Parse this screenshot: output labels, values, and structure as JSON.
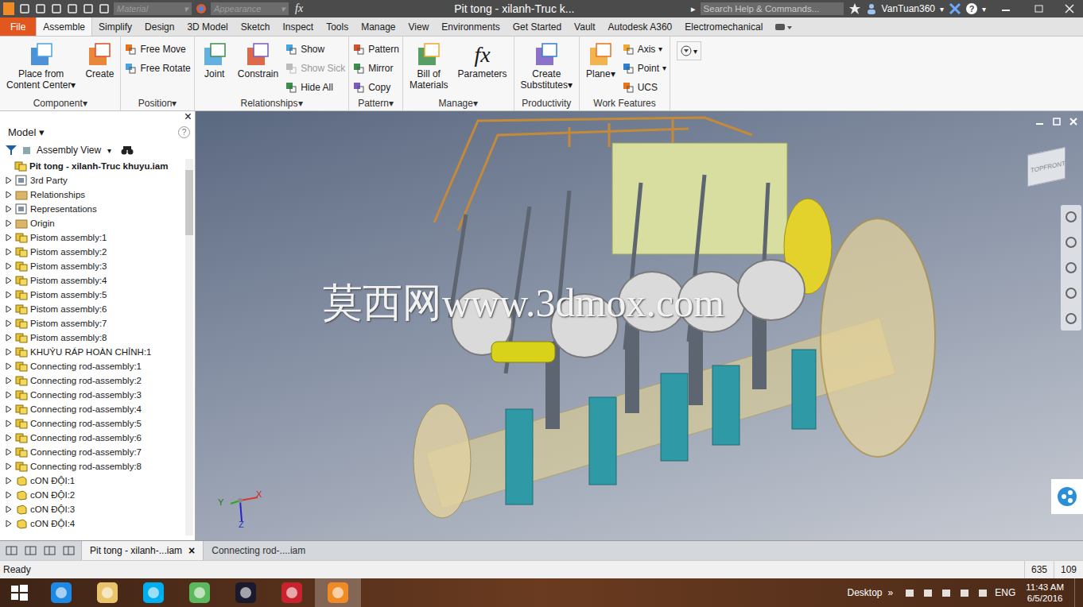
{
  "window": {
    "title": "Pit tong - xilanh-Truc k...",
    "search": {
      "placeholder": "Search Help & Commands..."
    },
    "user": "VanTuan360",
    "material": "Material",
    "appearance": "Appearance",
    "fx": "fx",
    "help": "?",
    "arrow": "▸"
  },
  "glyphs": {
    "dropdown": "▾",
    "close": "×"
  },
  "ribbon_tabs": [
    {
      "label": "File",
      "selected": false,
      "kind": "file"
    },
    {
      "label": "Assemble",
      "selected": true,
      "kind": "tab"
    },
    {
      "label": "Simplify",
      "selected": false,
      "kind": "tab"
    },
    {
      "label": "Design",
      "selected": false,
      "kind": "tab"
    },
    {
      "label": "3D Model",
      "selected": false,
      "kind": "tab"
    },
    {
      "label": "Sketch",
      "selected": false,
      "kind": "tab"
    },
    {
      "label": "Inspect",
      "selected": false,
      "kind": "tab"
    },
    {
      "label": "Tools",
      "selected": false,
      "kind": "tab"
    },
    {
      "label": "Manage",
      "selected": false,
      "kind": "tab"
    },
    {
      "label": "View",
      "selected": false,
      "kind": "tab"
    },
    {
      "label": "Environments",
      "selected": false,
      "kind": "tab"
    },
    {
      "label": "Get Started",
      "selected": false,
      "kind": "tab"
    },
    {
      "label": "Vault",
      "selected": false,
      "kind": "tab"
    },
    {
      "label": "Autodesk A360",
      "selected": false,
      "kind": "tab"
    },
    {
      "label": "Electromechanical",
      "selected": false,
      "kind": "tab"
    }
  ],
  "ribbon_groups": [
    {
      "label": "Component",
      "menu": true,
      "tools": [
        {
          "lines": [
            "Place from",
            "Content Center"
          ],
          "size": "large",
          "menu": true,
          "disabled": false
        },
        {
          "lines": [
            "Create"
          ],
          "size": "large",
          "menu": false,
          "disabled": false
        }
      ]
    },
    {
      "label": "Position",
      "menu": true,
      "tools": [
        {
          "lines": [
            "Free Move"
          ],
          "size": "small",
          "menu": false,
          "disabled": false
        },
        {
          "lines": [
            "Free Rotate"
          ],
          "size": "small",
          "menu": false,
          "disabled": false
        }
      ]
    },
    {
      "label": "Relationships",
      "menu": true,
      "tools": [
        {
          "lines": [
            "Joint"
          ],
          "size": "large",
          "menu": false,
          "disabled": false
        },
        {
          "lines": [
            "Constrain"
          ],
          "size": "large",
          "menu": false,
          "disabled": false
        },
        {
          "lines": [
            "Show"
          ],
          "size": "small",
          "menu": false,
          "disabled": false
        },
        {
          "lines": [
            "Show Sick"
          ],
          "size": "small",
          "menu": false,
          "disabled": true
        },
        {
          "lines": [
            "Hide All"
          ],
          "size": "small",
          "menu": false,
          "disabled": false
        }
      ]
    },
    {
      "label": "Pattern",
      "menu": true,
      "tools": [
        {
          "lines": [
            "Pattern"
          ],
          "size": "small",
          "menu": false,
          "disabled": false
        },
        {
          "lines": [
            "Mirror"
          ],
          "size": "small",
          "menu": false,
          "disabled": false
        },
        {
          "lines": [
            "Copy"
          ],
          "size": "small",
          "menu": false,
          "disabled": false
        }
      ]
    },
    {
      "label": "Manage",
      "menu": true,
      "tools": [
        {
          "lines": [
            "Bill of",
            "Materials"
          ],
          "size": "large",
          "menu": false,
          "disabled": false
        },
        {
          "lines": [
            "Parameters"
          ],
          "size": "large",
          "menu": false,
          "disabled": false,
          "icon_text": "fx"
        }
      ]
    },
    {
      "label": "Productivity",
      "menu": false,
      "tools": [
        {
          "lines": [
            "Create",
            "Substitutes"
          ],
          "size": "large",
          "menu": true,
          "disabled": false
        }
      ]
    },
    {
      "label": "Work Features",
      "menu": false,
      "tools": [
        {
          "lines": [
            "Plane"
          ],
          "size": "large",
          "menu": true,
          "disabled": false
        },
        {
          "lines": [
            "Axis"
          ],
          "size": "small",
          "menu": true,
          "disabled": false
        },
        {
          "lines": [
            "Point"
          ],
          "size": "small",
          "menu": true,
          "disabled": false
        },
        {
          "lines": [
            "UCS"
          ],
          "size": "small",
          "menu": false,
          "disabled": false
        }
      ]
    }
  ],
  "browser": {
    "title": "Model",
    "help": "?",
    "close": "×",
    "view": "Assembly View",
    "root": "Pit tong - xilanh-Truc khuyu.iam",
    "items": [
      {
        "label": "3rd Party",
        "kind": "special",
        "expanded": false
      },
      {
        "label": "Relationships",
        "kind": "folder",
        "expanded": false
      },
      {
        "label": "Representations",
        "kind": "special",
        "expanded": false
      },
      {
        "label": "Origin",
        "kind": "folder",
        "expanded": false
      },
      {
        "label": "Pistom assembly:1",
        "kind": "assembly",
        "expanded": false
      },
      {
        "label": "Pistom assembly:2",
        "kind": "assembly",
        "expanded": false
      },
      {
        "label": "Pistom assembly:3",
        "kind": "assembly",
        "expanded": false
      },
      {
        "label": "Pistom assembly:4",
        "kind": "assembly",
        "expanded": false
      },
      {
        "label": "Pistom assembly:5",
        "kind": "assembly",
        "expanded": false
      },
      {
        "label": "Pistom assembly:6",
        "kind": "assembly",
        "expanded": false
      },
      {
        "label": "Pistom assembly:7",
        "kind": "assembly",
        "expanded": false
      },
      {
        "label": "Pistom assembly:8",
        "kind": "assembly",
        "expanded": false
      },
      {
        "label": "KHUỶU RÁP HOÀN CHỈNH:1",
        "kind": "assembly",
        "expanded": false
      },
      {
        "label": "Connecting rod-assembly:1",
        "kind": "assembly",
        "expanded": false
      },
      {
        "label": "Connecting rod-assembly:2",
        "kind": "assembly",
        "expanded": false
      },
      {
        "label": "Connecting rod-assembly:3",
        "kind": "assembly",
        "expanded": false
      },
      {
        "label": "Connecting rod-assembly:4",
        "kind": "assembly",
        "expanded": false
      },
      {
        "label": "Connecting rod-assembly:5",
        "kind": "assembly",
        "expanded": false
      },
      {
        "label": "Connecting rod-assembly:6",
        "kind": "assembly",
        "expanded": false
      },
      {
        "label": "Connecting rod-assembly:7",
        "kind": "assembly",
        "expanded": false
      },
      {
        "label": "Connecting rod-assembly:8",
        "kind": "assembly",
        "expanded": false
      },
      {
        "label": "cON ĐỘI:1",
        "kind": "part",
        "expanded": false
      },
      {
        "label": "cON ĐỘI:2",
        "kind": "part",
        "expanded": false
      },
      {
        "label": "cON ĐỘI:3",
        "kind": "part",
        "expanded": false
      },
      {
        "label": "cON ĐỘI:4",
        "kind": "part",
        "expanded": false
      }
    ]
  },
  "viewport": {
    "watermark": "莫西网www.3dmox.com",
    "viewcube": {
      "top": "TOP",
      "front": "FRONT"
    },
    "axes": {
      "x": "X",
      "y": "Y",
      "z": "Z"
    }
  },
  "document_tabs": [
    {
      "label": "Pit tong - xilanh-...iam",
      "selected": true
    },
    {
      "label": "Connecting rod-....iam",
      "selected": false
    }
  ],
  "status_bar": {
    "message": "Ready",
    "x": "635",
    "y": "109"
  },
  "taskbar": {
    "apps": [
      {
        "kind": "ie",
        "selected": false
      },
      {
        "kind": "explorer",
        "selected": false
      },
      {
        "kind": "skype",
        "selected": false
      },
      {
        "kind": "corel",
        "selected": false
      },
      {
        "kind": "flash",
        "selected": false
      },
      {
        "kind": "solidworks",
        "selected": false
      },
      {
        "kind": "inventor",
        "selected": true
      }
    ],
    "desktop": "Desktop",
    "more": "»",
    "language": "ENG",
    "time": "11:43 AM",
    "date": "6/5/2016"
  }
}
